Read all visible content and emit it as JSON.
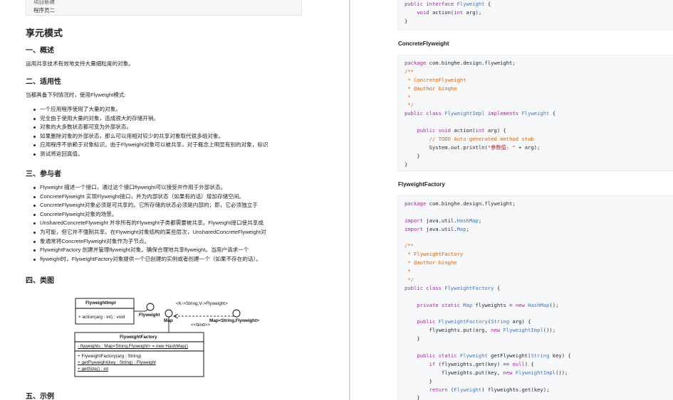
{
  "left_page": {
    "info_box": {
      "line1": "项目新建",
      "line2": "程序员二"
    },
    "title": "享元模式",
    "sections": {
      "overview": {
        "heading": "一、概述",
        "text": "运用共享技术有效地支持大量细粒度的对象。"
      },
      "applicability": {
        "heading": "二、适用性",
        "intro": "当都具备下列情况时，使用Flyweight模式:",
        "items": [
          "一个应用程序使用了大量的对象。",
          "完全由于使用大量的对象，造成很大的存储开销。",
          "对象的大多数状态都可变为外部状态。",
          "如果删除对象的外部状态，那么可以用相对较少的共享对象取代很多组对象。",
          "应用程序不依赖于对象标识。由于Flyweight对象可以被共享，对于概念上明显有别的对象，标识",
          "测试将返回真值。"
        ]
      },
      "participants": {
        "heading": "三、参与者",
        "items": [
          "Flyweight 描述一个接口，通过这个接口flyweight可以接受并作用于外部状态。",
          "ConcreteFlyweight 实现Flyweight接口，并为内部状态（如果有的话）增加存储空间。",
          "ConcreteFlyweight对象必须是可共享的。它所存储的状态必须是内部的；即，它必须独立于",
          "ConcreteFlyweight对象的场景。",
          "UnsharedConcreteFlyweight 并非所有的Flyweight子类都需要被共享。Flyweight接口使共享成",
          "为可能，但它并不强制共享。在Flyweight对象结构的某些层次，UnsharedConcreteFlyweight对",
          "象通常将ConcreteFlyweight对象作为子节点。",
          "FlyweightFactory 创建并管理flyweight对象。确保合理地共享flyweight。当用户请求一个",
          "flyweight时，FlyweightFactory对象提供一个已创建的实例或者创建一个（如果不存在的话）。"
        ]
      },
      "diagram": {
        "heading": "四、类图"
      },
      "example": {
        "heading": "五、示例"
      }
    },
    "uml": {
      "impl_box_title": "FlyweightImpl",
      "impl_box_method": "+ action(arg : int) : void",
      "flyweight_label": "Flyweight",
      "map_label": "Map",
      "generic_label": "<K->String,V->Flyweight>",
      "bind_label": "<<bind>>",
      "map_string_label": "Map<String,Flyweight>",
      "factory_title": "FlyweightFactory",
      "factory_field": "- flyweights : Map<String,Flyweight> = new HashMap()",
      "factory_methods": [
        "+ FlyweightFactory(arg : String)",
        "+ getFlyweight(key : String) : Flyweight",
        "+ getSize() : int"
      ]
    }
  },
  "right_page": {
    "block1_lines": [
      "public interface Flyweight {",
      "    void action(int arg);",
      "}"
    ],
    "concrete_title": "ConcreteFlyweight",
    "block2_lines": [
      "package com.binghe.design.flyweight;",
      "/**",
      " * ConcreteFlyweight",
      " * @author binghe",
      " *",
      " */",
      "public class FlyweightImpl implements Flyweight {",
      "",
      "    public void action(int arg) {",
      "        // TODO Auto-generated method stub",
      "        System.out.println(\"参数值: \" + arg);",
      "    }",
      "}"
    ],
    "factory_title": "FlyweightFactory",
    "block3_lines": [
      "package com.binghe.design.flyweight;",
      "",
      "import java.util.HashMap;",
      "import java.util.Map;",
      "",
      "/**",
      " * FlyweightFactory",
      " * @author binghe",
      " *",
      " */",
      "public class FlyweightFactory {",
      "",
      "    private static Map flyweights = new HashMap();",
      "",
      "    public FlyweightFactory(String arg) {",
      "        flyweights.put(arg, new FlyweightImpl());",
      "    }",
      "",
      "    public static Flyweight getFlyweight(String key) {",
      "        if (flyweights.get(key) == null) {",
      "            flyweights.put(key, new FlyweightImpl());",
      "        }",
      "        return (Flyweight) flyweights.get(key);",
      "    }"
    ]
  }
}
